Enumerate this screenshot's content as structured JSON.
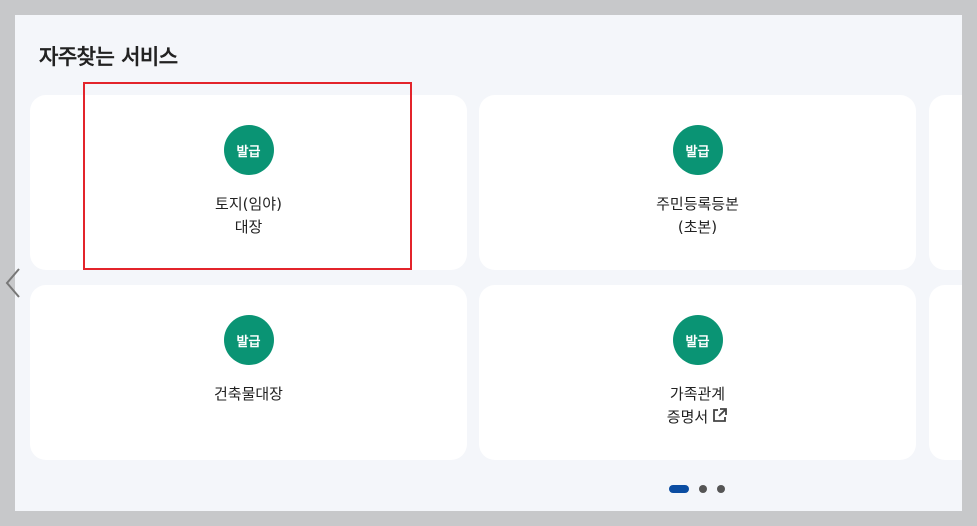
{
  "section": {
    "title": "자주찾는 서비스"
  },
  "services": [
    {
      "badge": "발급",
      "line1": "토지(임야)",
      "line2": "대장",
      "external": false
    },
    {
      "badge": "발급",
      "line1": "주민등록등본",
      "line2": "(초본)",
      "external": false
    },
    {
      "badge": "발급",
      "line1": "건축물대장",
      "line2": "",
      "external": false
    },
    {
      "badge": "발급",
      "line1": "가족관계",
      "line2": "증명서",
      "external": true
    }
  ],
  "pagination": {
    "pages": 3,
    "active_page": 1
  },
  "icons": {
    "prev": "chevron-left-icon",
    "external": "external-link-icon"
  },
  "colors": {
    "badge": "#0a9474",
    "highlight": "#e3242b",
    "active_dot": "#0b4da2",
    "panel_bg": "#f4f6fa"
  }
}
